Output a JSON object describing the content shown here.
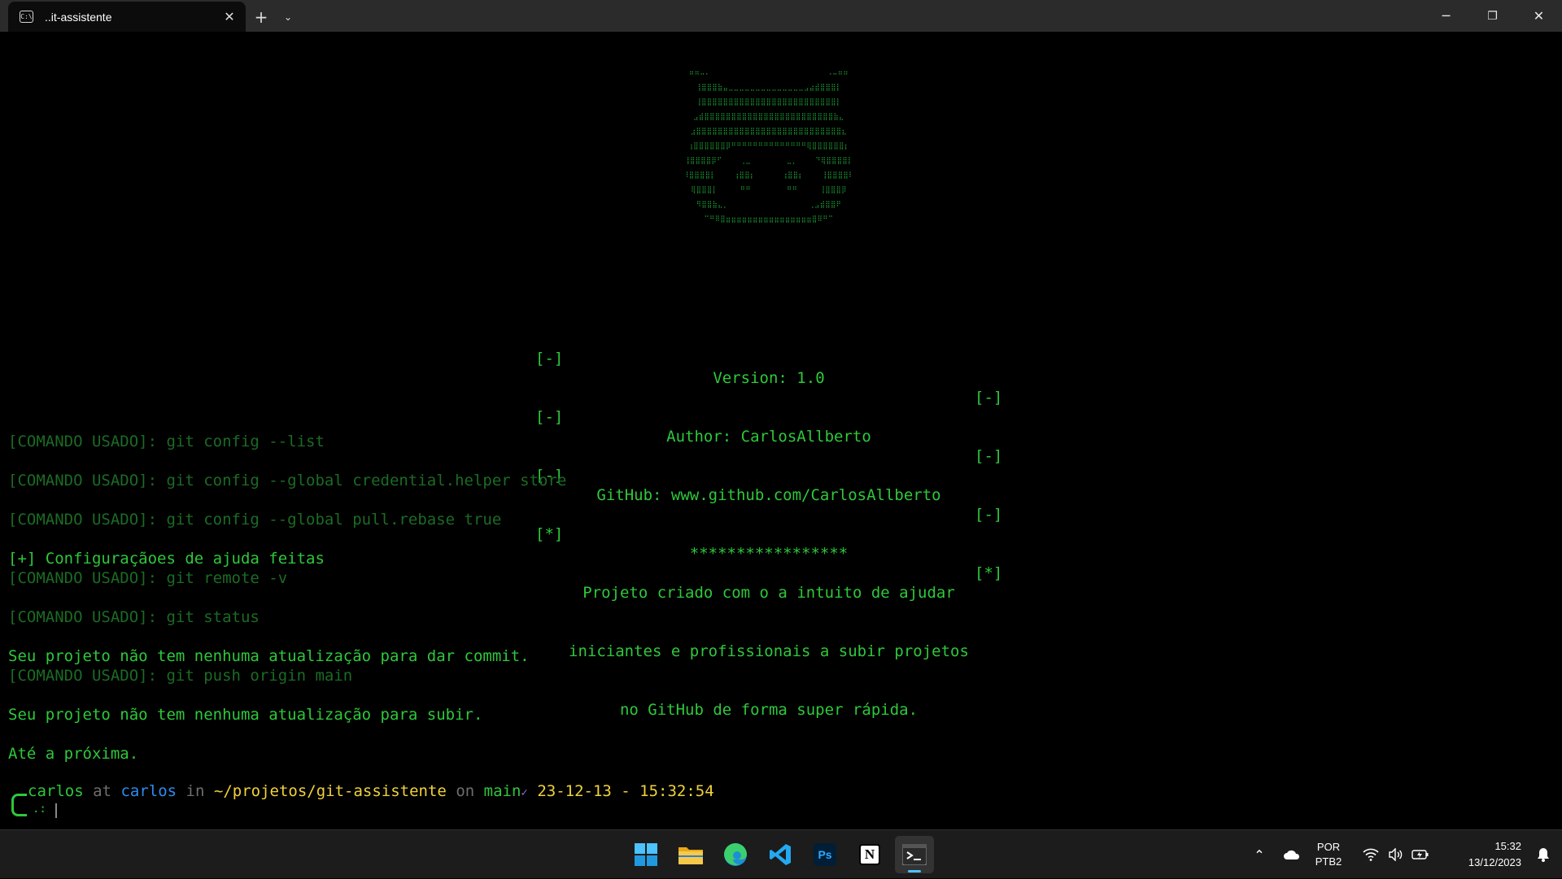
{
  "window": {
    "tab_title": "..it-assistente",
    "new_tab_icon": "plus-icon",
    "tab_menu_icon": "chevron-down-icon"
  },
  "ascii_logo": "      ⠶⠶⠤⠄                          ⠠⠤⠶⠶      \n     ⢸⣿⣿⣿⣷⣤⣀⣀⣀⣀⣀⣀⣀⣀⣀⣀⣀⣀⣀⣀⣠⣴⣾⣿⣿⣿⡇     \n     ⢸⣿⣿⣿⣿⣿⣿⣿⣿⣿⣿⣿⣿⣿⣿⣿⣿⣿⣿⣿⣿⣿⣿⣿⣿⣿⡇     \n    ⣠⣾⣿⣿⣿⣿⣿⣿⣿⣿⣿⣿⣿⣿⣿⣿⣿⣿⣿⣿⣿⣿⣿⣿⣿⣿⣷⣄    \n   ⣰⣿⣿⣿⣿⣿⣿⣿⣿⣿⣿⣿⣿⣿⣿⣿⣿⣿⣿⣿⣿⣿⣿⣿⣿⣿⣿⣿⣆   \n  ⢰⣿⣿⣿⣿⣿⣿⡿⠛⠛⠛⠛⠛⠛⠛⠛⠛⠛⠛⠛⠛⠛⢿⣿⣿⣿⣿⣿⣿⡆  \n  ⢸⣿⣿⣿⣿⡿⠋    ⢀⣀        ⣀⡀    ⠙⢿⣿⣿⣿⣿⡇  \n  ⠸⣿⣿⣿⣿⡇    ⢰⣿⣿⡆      ⢰⣿⣿⡆    ⢸⣿⣿⣿⣿⠇  \n   ⢿⣿⣿⣿⡇     ⠛⠛        ⠛⠛     ⢸⣿⣿⣿⡿   \n    ⠻⣿⣿⣷⣄⡀                  ⢀⣠⣾⣿⣿⠟    \n      ⠉⠛⠿⣿⣶⣶⣶⣶⣶⣶⣶⣶⣶⣶⣶⣶⣶⣶⣶⣶⣿⠿⠛⠉      ",
  "banner": {
    "bracket_dash": "[-]",
    "bracket_star": "[*]",
    "version": "Version: 1.0",
    "author": "Author: CarlosAllberto",
    "github": "GitHub: www.github.com/CarlosAllberto",
    "stars": "*****************",
    "description": [
      "Projeto criado com o a intuito de ajudar",
      "iniciantes e profissionais a subir projetos",
      "no GitHub de forma super rápida."
    ]
  },
  "log": [
    {
      "text": "[COMANDO USADO]: git config --list",
      "style": "dim"
    },
    {
      "text": "",
      "style": "dim"
    },
    {
      "text": "[COMANDO USADO]: git config --global credential.helper store",
      "style": "dim"
    },
    {
      "text": "",
      "style": "dim"
    },
    {
      "text": "[COMANDO USADO]: git config --global pull.rebase true",
      "style": "dim"
    },
    {
      "text": "",
      "style": "dim"
    },
    {
      "text": "[+] Configuraçãoes de ajuda feitas",
      "style": "ok"
    },
    {
      "text": "[COMANDO USADO]: git remote -v",
      "style": "dim"
    },
    {
      "text": "",
      "style": "dim"
    },
    {
      "text": "[COMANDO USADO]: git status",
      "style": "dim"
    },
    {
      "text": "",
      "style": "dim"
    },
    {
      "text": "Seu projeto não tem nenhuma atualização para dar commit.",
      "style": "ok"
    },
    {
      "text": "[COMANDO USADO]: git push origin main",
      "style": "dim"
    },
    {
      "text": "",
      "style": "dim"
    },
    {
      "text": "Seu projeto não tem nenhuma atualização para subir.",
      "style": "ok"
    },
    {
      "text": "",
      "style": "dim"
    },
    {
      "text": "Até a próxima.",
      "style": "ok"
    }
  ],
  "prompt": {
    "user": "carlos",
    "at": "at",
    "host": "carlos",
    "in": "in",
    "path": "~/projetos/git-assistente",
    "on": "on",
    "branch": "main",
    "check": "✓",
    "timestamp": "23-12-13 - 15:32:54",
    "symbol": ".:"
  },
  "taskbar": {
    "apps": [
      {
        "name": "start-button",
        "icon": "windows-logo-icon"
      },
      {
        "name": "file-explorer",
        "icon": "folder-icon"
      },
      {
        "name": "edge-browser",
        "icon": "edge-icon"
      },
      {
        "name": "vscode",
        "icon": "vscode-icon"
      },
      {
        "name": "photoshop",
        "icon": "photoshop-icon",
        "label": "Ps"
      },
      {
        "name": "notion",
        "icon": "notion-icon",
        "label": "N"
      },
      {
        "name": "terminal",
        "icon": "terminal-icon",
        "active": true
      }
    ],
    "lang_top": "POR",
    "lang_bottom": "PTB2",
    "time": "15:32",
    "date": "13/12/2023"
  },
  "colors": {
    "terminal_green": "#2ec83a",
    "dim_green": "#1b6b24",
    "path_yellow": "#f0d23a",
    "host_blue": "#2d8cf0",
    "accent": "#4cc2ff"
  }
}
